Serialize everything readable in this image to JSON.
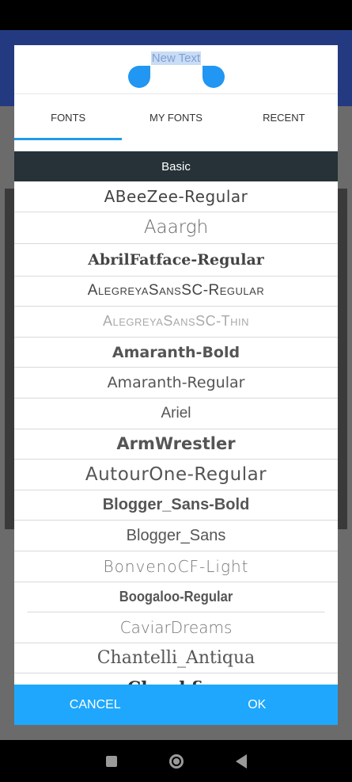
{
  "dialog": {
    "preview_text": "New Text",
    "tabs": [
      {
        "label": "FONTS",
        "active": true
      },
      {
        "label": "MY FONTS",
        "active": false
      },
      {
        "label": "RECENT",
        "active": false
      }
    ],
    "section": "Basic",
    "fonts": [
      "ABeeZee-Regular",
      "Aaargh",
      "AbrilFatface-Regular",
      "AlegreyaSansSC-Regular",
      "AlegreyaSansSC-Thin",
      "Amaranth-Bold",
      "Amaranth-Regular",
      "Ariel",
      "ArmWrestler",
      "AutourOne-Regular",
      "Blogger_Sans-Bold",
      "Blogger_Sans",
      "BonvenoCF-Light",
      "Boogaloo-Regular",
      "CaviarDreams",
      "Chantelli_Antiqua",
      "Chunkfive"
    ],
    "cancel_label": "CANCEL",
    "ok_label": "OK"
  },
  "colors": {
    "accent": "#1ea7fd",
    "header_dark": "#263238",
    "handle": "#2196f3",
    "app_bar": "#233a80"
  }
}
